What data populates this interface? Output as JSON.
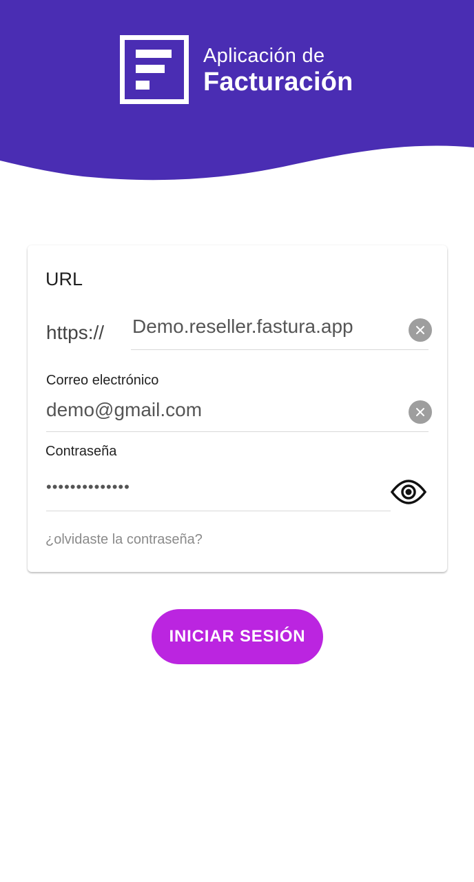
{
  "header": {
    "brand_line1": "Aplicación de",
    "brand_line2": "Facturación",
    "logo_icon": "invoice-logo-icon",
    "background_color": "#4a2db3"
  },
  "form": {
    "url_label": "URL",
    "url_prefix": "https://",
    "url_value": "Demo.reseller.fastura.app",
    "email_label": "Correo electrónico",
    "email_value": "demo@gmail.com",
    "password_label": "Contraseña",
    "password_value": "••••••••••••••",
    "forgot_link": "¿olvidaste la contraseña?",
    "clear_icon": "close-icon",
    "visibility_icon": "eye-icon"
  },
  "actions": {
    "login_label": "INICIAR SESIÓN",
    "login_color": "#bb25e0"
  }
}
